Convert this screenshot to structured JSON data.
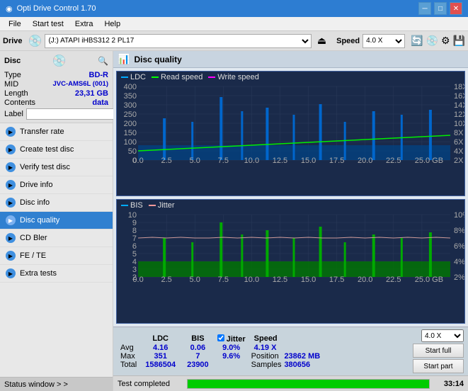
{
  "titlebar": {
    "title": "Opti Drive Control 1.70",
    "icon": "◉",
    "minimize": "─",
    "maximize": "□",
    "close": "✕"
  },
  "menubar": {
    "items": [
      "File",
      "Start test",
      "Extra",
      "Help"
    ]
  },
  "drive": {
    "label": "Drive",
    "value": "(J:) ATAPI iHBS312  2 PL17",
    "speed_label": "Speed",
    "speed_value": "4.0 X"
  },
  "disc": {
    "header": "Disc",
    "type_label": "Type",
    "type_value": "BD-R",
    "mid_label": "MID",
    "mid_value": "JVC-AMS6L (001)",
    "length_label": "Length",
    "length_value": "23,31 GB",
    "contents_label": "Contents",
    "contents_value": "data",
    "label_label": "Label",
    "label_value": ""
  },
  "nav": {
    "items": [
      {
        "id": "transfer-rate",
        "label": "Transfer rate",
        "active": false
      },
      {
        "id": "create-test-disc",
        "label": "Create test disc",
        "active": false
      },
      {
        "id": "verify-test-disc",
        "label": "Verify test disc",
        "active": false
      },
      {
        "id": "drive-info",
        "label": "Drive info",
        "active": false
      },
      {
        "id": "disc-info",
        "label": "Disc info",
        "active": false
      },
      {
        "id": "disc-quality",
        "label": "Disc quality",
        "active": true
      },
      {
        "id": "cd-bler",
        "label": "CD Bler",
        "active": false
      },
      {
        "id": "fe-te",
        "label": "FE / TE",
        "active": false
      },
      {
        "id": "extra-tests",
        "label": "Extra tests",
        "active": false
      }
    ]
  },
  "chart_title": "Disc quality",
  "chart1": {
    "legend": [
      {
        "label": "LDC",
        "color": "#00aaff"
      },
      {
        "label": "Read speed",
        "color": "#00ff00"
      },
      {
        "label": "Write speed",
        "color": "#ff00ff"
      }
    ],
    "y_max": 400,
    "y_labels": [
      "400",
      "350",
      "300",
      "250",
      "200",
      "150",
      "100",
      "50",
      "0"
    ],
    "y_right_labels": [
      "18X",
      "16X",
      "14X",
      "12X",
      "10X",
      "8X",
      "6X",
      "4X",
      "2X"
    ],
    "x_labels": [
      "0.0",
      "2.5",
      "5.0",
      "7.5",
      "10.0",
      "12.5",
      "15.0",
      "17.5",
      "20.0",
      "22.5",
      "25.0 GB"
    ]
  },
  "chart2": {
    "legend": [
      {
        "label": "BIS",
        "color": "#00aaff"
      },
      {
        "label": "Jitter",
        "color": "#ff9999"
      }
    ],
    "y_max": 10,
    "y_labels": [
      "10",
      "9",
      "8",
      "7",
      "6",
      "5",
      "4",
      "3",
      "2",
      "1"
    ],
    "y_right_labels": [
      "10%",
      "8%",
      "6%",
      "4%",
      "2%"
    ],
    "x_labels": [
      "0.0",
      "2.5",
      "5.0",
      "7.5",
      "10.0",
      "12.5",
      "15.0",
      "17.5",
      "20.0",
      "22.5",
      "25.0 GB"
    ]
  },
  "stats": {
    "col_ldc": "LDC",
    "col_bis": "BIS",
    "col_jitter": "Jitter",
    "col_speed": "Speed",
    "row_avg": "Avg",
    "row_max": "Max",
    "row_total": "Total",
    "avg_ldc": "4.16",
    "avg_bis": "0.06",
    "avg_jitter": "9.0%",
    "avg_speed": "4.19 X",
    "max_ldc": "351",
    "max_bis": "7",
    "max_jitter": "9.6%",
    "position_label": "Position",
    "position_value": "23862 MB",
    "total_ldc": "1586504",
    "total_bis": "23900",
    "samples_label": "Samples",
    "samples_value": "380656",
    "btn_start_full": "Start full",
    "btn_start_part": "Start part",
    "speed_select": "4.0 X"
  },
  "statusbar": {
    "status_text": "Test completed",
    "progress": 100,
    "time": "33:14"
  },
  "status_window": {
    "label": "Status window > >"
  }
}
